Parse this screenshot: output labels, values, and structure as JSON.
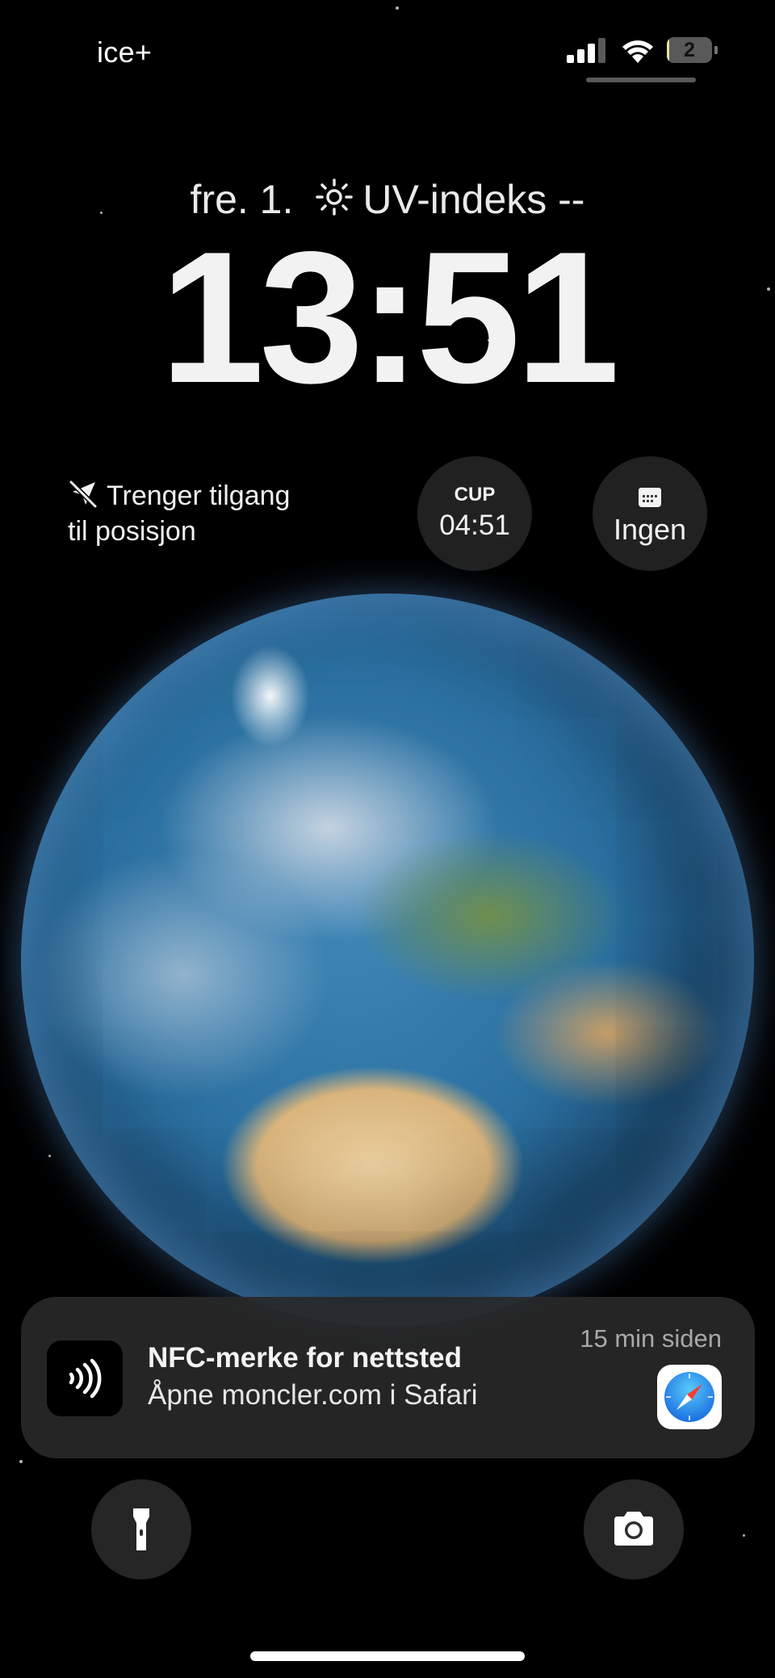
{
  "status_bar": {
    "carrier": "ice+",
    "battery_level": "2",
    "battery_fill_fraction": 0.02,
    "signal_bars_active": 3,
    "signal_bars_total": 4
  },
  "lock_screen": {
    "date": "fre. 1.",
    "weather": "UV-indeks --",
    "time": "13:51"
  },
  "widgets": {
    "location": {
      "line1": "Trenger tilgang",
      "line2": "til posisjon"
    },
    "world_clock": {
      "label": "CUP",
      "time": "04:51"
    },
    "calendar": {
      "label": "Ingen"
    }
  },
  "notification": {
    "title": "NFC-merke for nettsted",
    "body": "Åpne moncler.com i Safari",
    "time": "15 min siden",
    "app_icon": "safari-icon",
    "source_icon": "nfc-icon"
  },
  "controls": {
    "left": "flashlight-icon",
    "right": "camera-icon"
  },
  "colors": {
    "background": "#000000",
    "text": "#f2f2f2",
    "notification_bg": "#282828",
    "battery_fill": "#e8dfa4"
  }
}
